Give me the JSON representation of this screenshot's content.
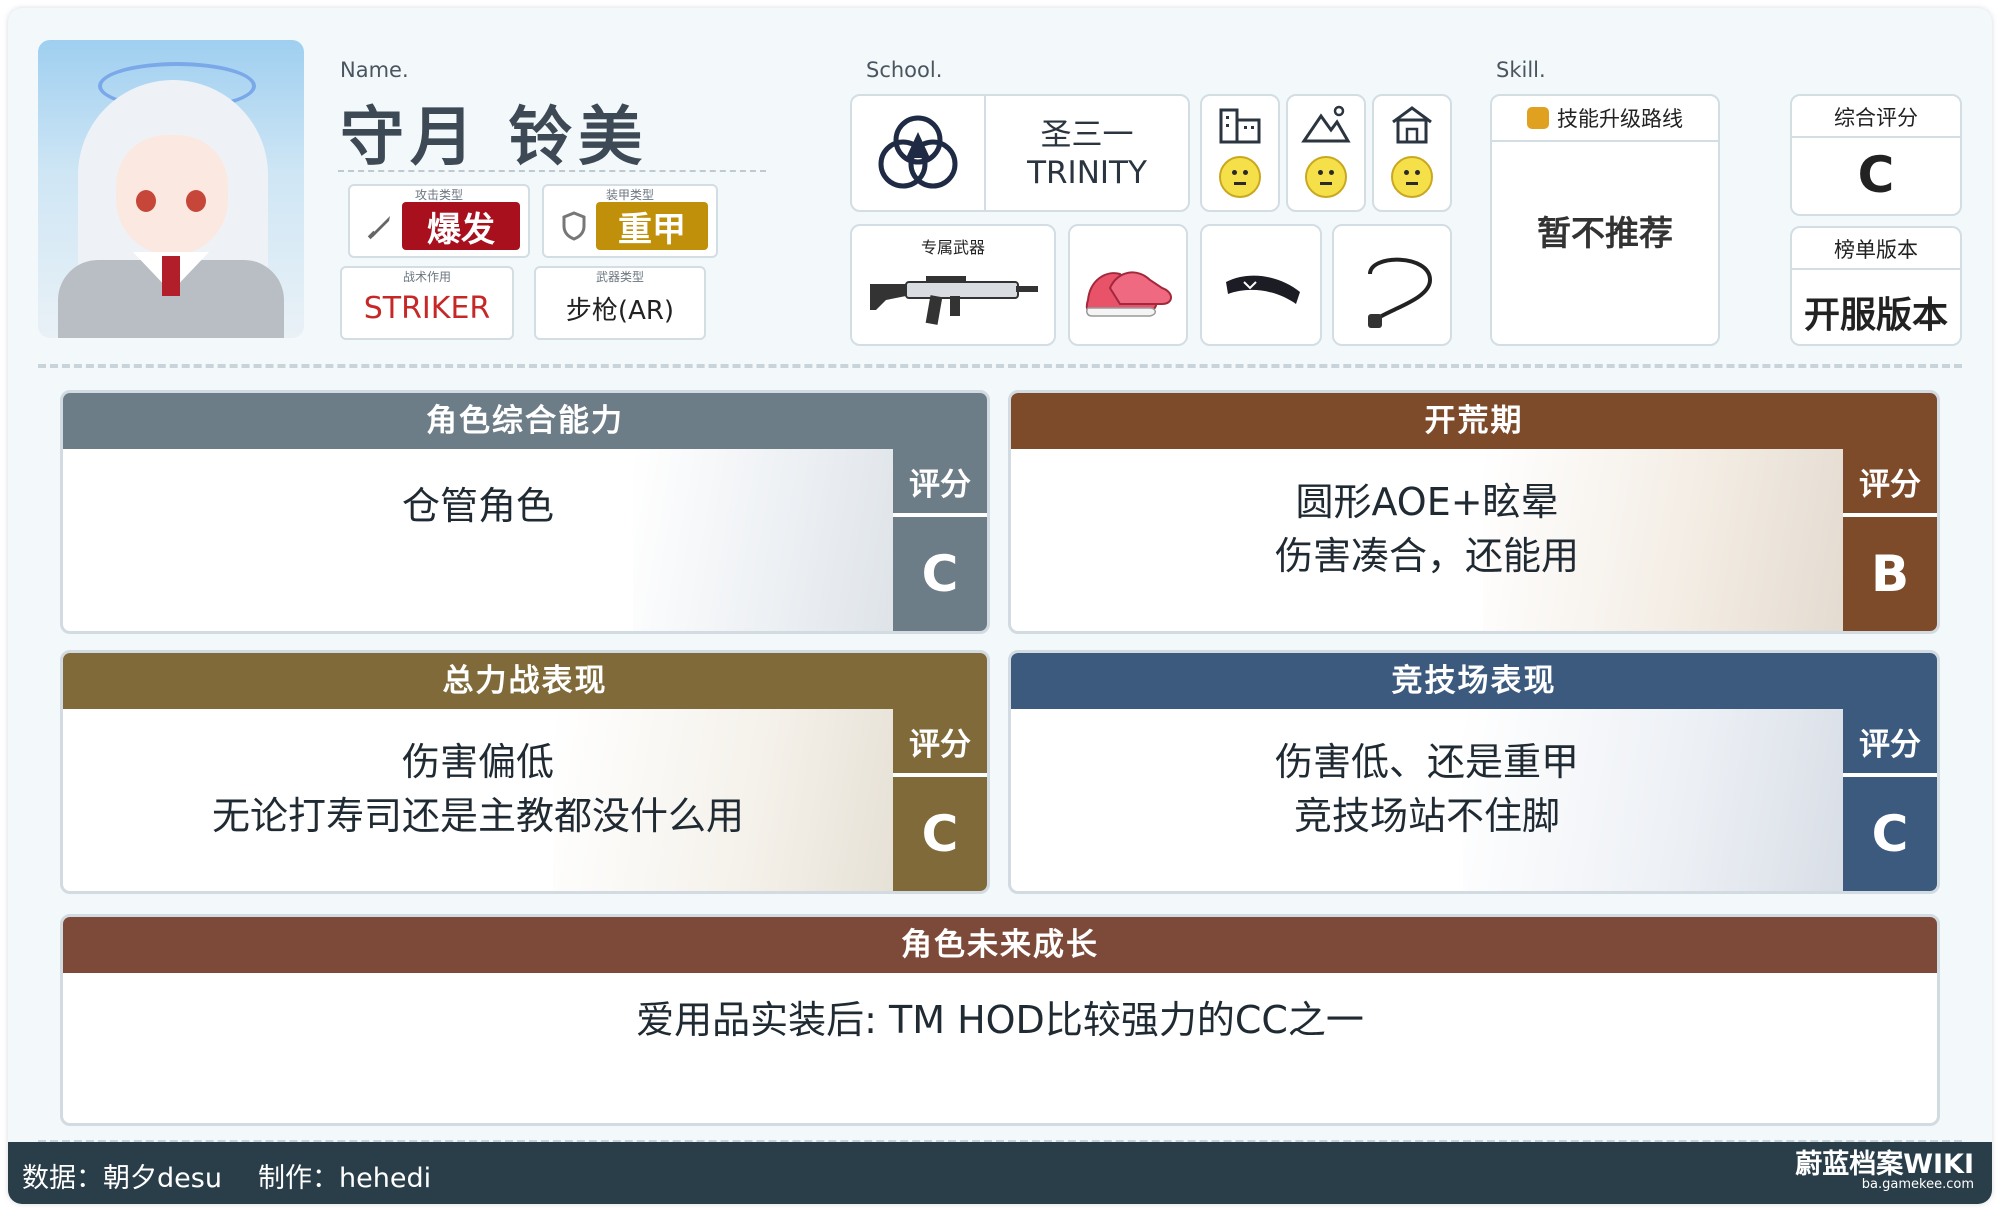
{
  "profile": {
    "name_label": "Name.",
    "name": "守月 铃美",
    "attack_type_caption": "攻击类型",
    "attack_type": "爆发",
    "armor_type_caption": "装甲类型",
    "armor_type": "重甲",
    "tactical_role_caption": "战术作用",
    "tactical_role": "STRIKER",
    "weapon_type_caption": "武器类型",
    "weapon_type": "步枪(AR)"
  },
  "school": {
    "label": "School.",
    "name_cn": "圣三一",
    "name_en": "TRINITY",
    "terrain": [
      {
        "icon": "city-icon",
        "glyph": "🏢",
        "mood": "neutral"
      },
      {
        "icon": "outdoor-icon",
        "glyph": "⛰",
        "mood": "neutral"
      },
      {
        "icon": "indoor-icon",
        "glyph": "🏠",
        "mood": "neutral"
      }
    ],
    "exclusive_weapon_label": "专属武器",
    "equipment": [
      "shoes-icon",
      "hairband-icon",
      "necklace-icon"
    ]
  },
  "skill": {
    "label": "Skill.",
    "route_label": "技能升级路线",
    "route_value": "暂不推荐"
  },
  "overall": {
    "caption": "综合评分",
    "value": "C",
    "version_caption": "榜单版本",
    "version_value": "开服版本"
  },
  "sections": {
    "ability": {
      "title": "角色综合能力",
      "lines": [
        "仓管角色"
      ],
      "rate_caption": "评分",
      "rate": "C",
      "color": "#6d7d87"
    },
    "early": {
      "title": "开荒期",
      "lines": [
        "圆形AOE+眩晕",
        "伤害凑合，还能用"
      ],
      "rate_caption": "评分",
      "rate": "B",
      "color": "#7d4a2a"
    },
    "raid": {
      "title": "总力战表现",
      "lines": [
        "伤害偏低",
        "无论打寿司还是主教都没什么用"
      ],
      "rate_caption": "评分",
      "rate": "C",
      "color": "#806a3a"
    },
    "arena": {
      "title": "竞技场表现",
      "lines": [
        "伤害低、还是重甲",
        "竞技场站不住脚"
      ],
      "rate_caption": "评分",
      "rate": "C",
      "color": "#3b5a7d"
    },
    "future": {
      "title": "角色未来成长",
      "lines": [
        "爱用品实装后: TM HOD比较强力的CC之一"
      ],
      "color": "#7d4a3a"
    }
  },
  "colors": {
    "attack_burst": "#a8101e",
    "armor_heavy": "#c0900a",
    "striker": "#c62828"
  },
  "footer": {
    "data_credit": "数据：朝夕desu",
    "made_by": "制作：hehedi",
    "brand": "蔚蓝档案WIKI",
    "brand_url": "ba.gamekee.com"
  }
}
